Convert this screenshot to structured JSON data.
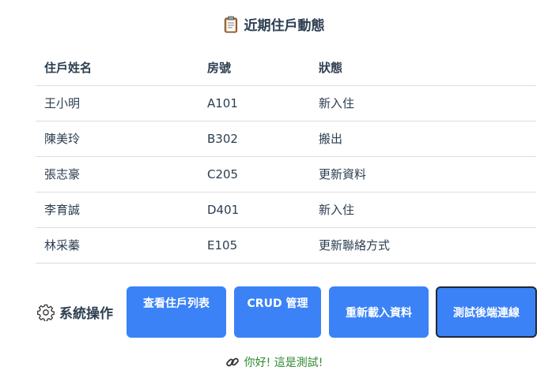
{
  "section_title": "近期住戶動態",
  "table": {
    "headers": [
      "住戶姓名",
      "房號",
      "狀態"
    ],
    "rows": [
      [
        "王小明",
        "A101",
        "新入住"
      ],
      [
        "陳美玲",
        "B302",
        "搬出"
      ],
      [
        "張志豪",
        "C205",
        "更新資料"
      ],
      [
        "李育誠",
        "D401",
        "新入住"
      ],
      [
        "林采蓁",
        "E105",
        "更新聯絡方式"
      ]
    ]
  },
  "operations": {
    "label": "系統操作",
    "buttons": {
      "view_list": "查看住戶列表",
      "crud": "CRUD 管理",
      "reload": "重新載入資料",
      "test_backend": "測試後端連線"
    }
  },
  "status_message": "你好! 這是測試!",
  "colors": {
    "button_bg": "#3b82f6",
    "text": "#2c3e50",
    "status_text": "#2e8b2e"
  },
  "icons": {
    "title": "clipboard-icon",
    "operations": "gear-icon",
    "status": "link-icon"
  }
}
